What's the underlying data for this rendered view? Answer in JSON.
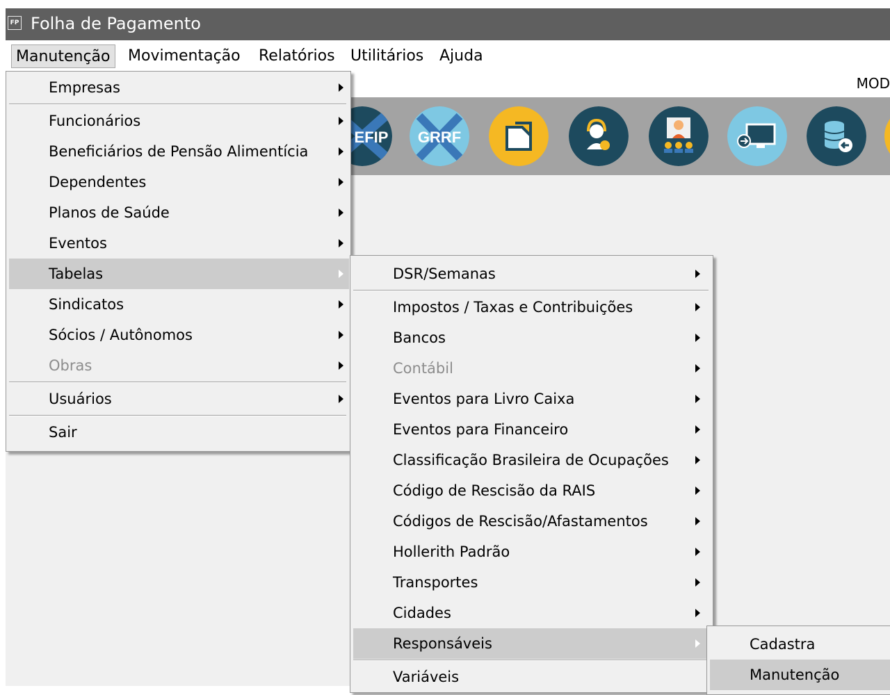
{
  "app": {
    "icon_text": "FP",
    "title": "Folha de Pagamento"
  },
  "menubar": [
    {
      "label": "Manutenção"
    },
    {
      "label": "Movimentação"
    },
    {
      "label": "Relatórios"
    },
    {
      "label": "Utilitários"
    },
    {
      "label": "Ajuda"
    }
  ],
  "toolbar": {
    "mod_text": "MOD",
    "icons": [
      {
        "name": "sefip-icon",
        "text": "EFIP"
      },
      {
        "name": "grrf-icon",
        "text": "GRRF"
      },
      {
        "name": "document-icon",
        "text": ""
      },
      {
        "name": "support-agent-icon",
        "text": ""
      },
      {
        "name": "users-meeting-icon",
        "text": ""
      },
      {
        "name": "remote-screen-icon",
        "text": ""
      },
      {
        "name": "database-restore-icon",
        "text": ""
      }
    ]
  },
  "menu_manutencao": {
    "items": [
      {
        "label": "Empresas"
      },
      {
        "label": "Funcionários"
      },
      {
        "label": "Beneficiários de Pensão Alimentícia"
      },
      {
        "label": "Dependentes"
      },
      {
        "label": "Planos de Saúde"
      },
      {
        "label": "Eventos"
      },
      {
        "label": "Tabelas"
      },
      {
        "label": "Sindicatos"
      },
      {
        "label": "Sócios / Autônomos"
      },
      {
        "label": "Obras"
      },
      {
        "label": "Usuários"
      },
      {
        "label": "Sair"
      }
    ]
  },
  "menu_tabelas": {
    "items": [
      {
        "label": "DSR/Semanas"
      },
      {
        "label": "Impostos / Taxas e Contribuições"
      },
      {
        "label": "Bancos"
      },
      {
        "label": "Contábil"
      },
      {
        "label": "Eventos para Livro Caixa"
      },
      {
        "label": "Eventos para Financeiro"
      },
      {
        "label": "Classificação Brasileira de Ocupações"
      },
      {
        "label": "Código de Rescisão da RAIS"
      },
      {
        "label": "Códigos de Rescisão/Afastamentos"
      },
      {
        "label": "Hollerith Padrão"
      },
      {
        "label": "Transportes"
      },
      {
        "label": "Cidades"
      },
      {
        "label": "Responsáveis"
      },
      {
        "label": "Variáveis"
      }
    ]
  },
  "menu_responsaveis": {
    "items": [
      {
        "label": "Cadastra"
      },
      {
        "label": "Manutenção"
      }
    ]
  },
  "colors": {
    "titlebar": "#5f5f5f",
    "menu_background": "#f0f0f0",
    "highlight": "#cccccc",
    "disabled_text": "#8d8d8d",
    "toolbar_background": "#a3a3a3"
  }
}
